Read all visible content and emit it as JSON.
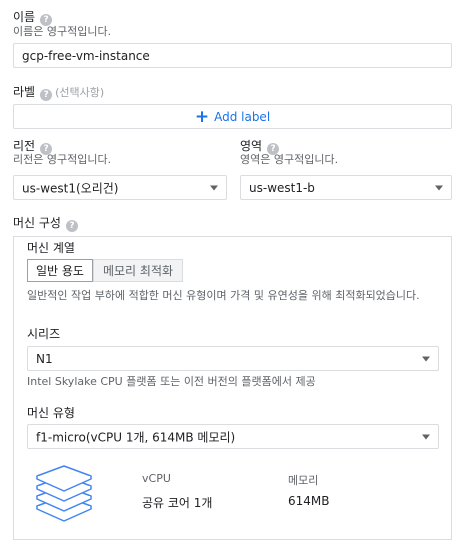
{
  "name": {
    "label": "이름",
    "hint": "이름은 영구적입니다.",
    "value": "gcp-free-vm-instance"
  },
  "labels": {
    "label": "라벨",
    "optional": "(선택사항)",
    "add_button": "Add label",
    "add_icon": "plus-icon"
  },
  "region": {
    "label": "리전",
    "hint": "리전은 영구적입니다.",
    "value": "us-west1(오리건)"
  },
  "zone": {
    "label": "영역",
    "hint": "영역은 영구적입니다.",
    "value": "us-west1-b"
  },
  "machine_config": {
    "label": "머신 구성",
    "family_label": "머신 계열",
    "tabs": [
      {
        "label": "일반 용도",
        "active": true
      },
      {
        "label": "메모리 최적화",
        "active": false
      }
    ],
    "family_desc": "일반적인 작업 부하에 적합한 머신 유형이며 가격 및 유연성을 위해 최적화되었습니다.",
    "series_label": "시리즈",
    "series_value": "N1",
    "series_desc": "Intel Skylake CPU 플랫폼 또는 이전 버전의 플랫폼에서 제공",
    "type_label": "머신 유형",
    "type_value": "f1-micro(vCPU 1개, 614MB 메모리)",
    "specs": {
      "icon": "stacked-layers-icon",
      "vcpu_header": "vCPU",
      "vcpu_value": "공유 코어 1개",
      "memory_header": "메모리",
      "memory_value": "614MB"
    }
  },
  "help_icon": "help-circle-icon",
  "colors": {
    "accent": "#1a73e8",
    "border": "#dadce0",
    "icon_blue": "#4285f4"
  }
}
